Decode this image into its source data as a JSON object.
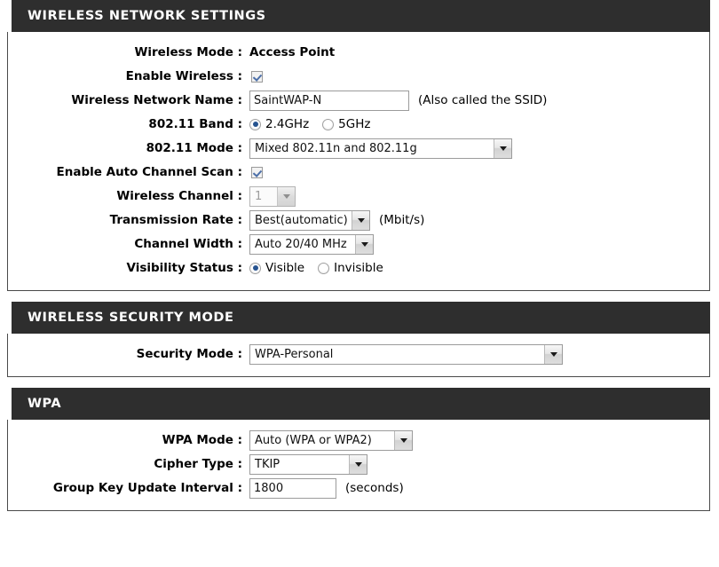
{
  "sections": [
    {
      "id": "wireless-network-settings",
      "title": "WIRELESS NETWORK SETTINGS",
      "rows": [
        {
          "label": "Wireless Mode :",
          "type": "static",
          "value": "Access Point"
        },
        {
          "label": "Enable Wireless :",
          "type": "checkbox",
          "checked": true
        },
        {
          "label": "Wireless Network Name :",
          "type": "text",
          "value": "SaintWAP-N",
          "hint": "(Also called the SSID)"
        },
        {
          "label": "802.11 Band :",
          "type": "radio",
          "options": [
            "2.4GHz",
            "5GHz"
          ],
          "selected": "2.4GHz"
        },
        {
          "label": "802.11 Mode :",
          "type": "select",
          "value": "Mixed 802.11n and 802.11g"
        },
        {
          "label": "Enable Auto Channel Scan :",
          "type": "checkbox",
          "checked": true
        },
        {
          "label": "Wireless Channel :",
          "type": "select",
          "value": "1",
          "disabled": true
        },
        {
          "label": "Transmission Rate :",
          "type": "select",
          "value": "Best(automatic)",
          "hint": "(Mbit/s)"
        },
        {
          "label": "Channel Width :",
          "type": "select",
          "value": "Auto 20/40 MHz"
        },
        {
          "label": "Visibility Status :",
          "type": "radio",
          "options": [
            "Visible",
            "Invisible"
          ],
          "selected": "Visible"
        }
      ]
    },
    {
      "id": "wireless-security-mode",
      "title": "WIRELESS SECURITY MODE",
      "rows": [
        {
          "label": "Security Mode :",
          "type": "select",
          "value": "WPA-Personal"
        }
      ]
    },
    {
      "id": "wpa",
      "title": "WPA",
      "rows": [
        {
          "label": "WPA Mode :",
          "type": "select",
          "value": "Auto (WPA or WPA2)"
        },
        {
          "label": "Cipher Type :",
          "type": "select",
          "value": "TKIP"
        },
        {
          "label": "Group Key Update Interval :",
          "type": "text",
          "value": "1800",
          "hint": "(seconds)"
        }
      ]
    }
  ],
  "colors": {
    "header_bg": "#2e2e2e",
    "header_text": "#ffffff",
    "panel_border": "#4a4a4a",
    "radio_dot": "#26538f",
    "check_mark": "#4c6fa8"
  }
}
